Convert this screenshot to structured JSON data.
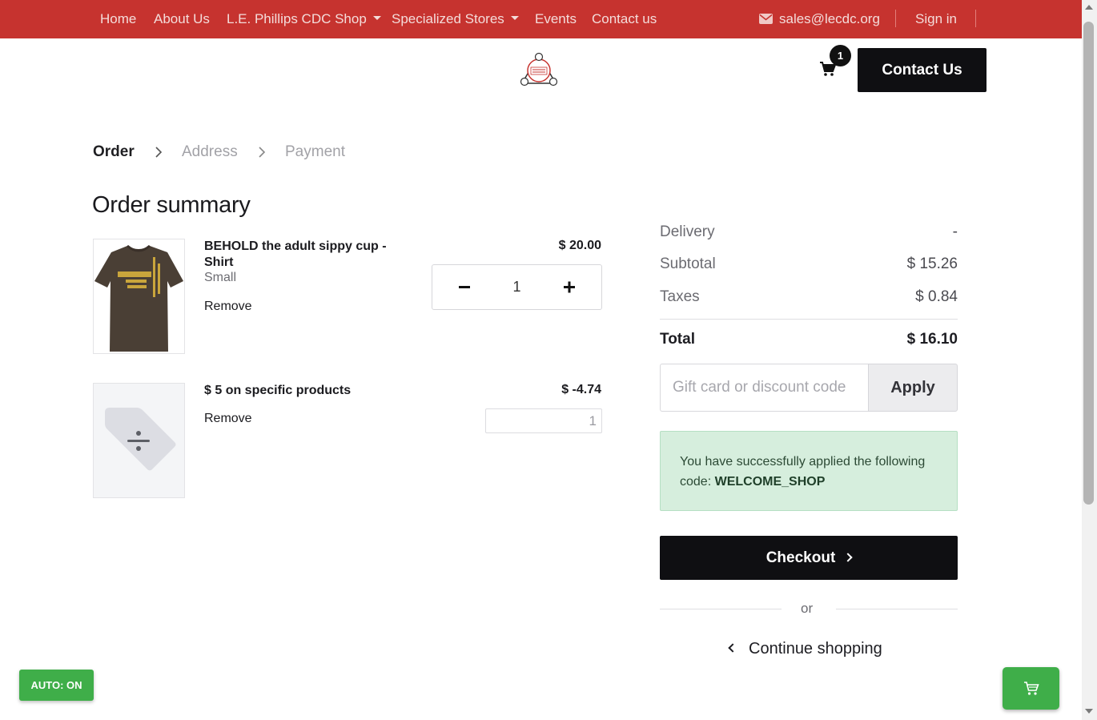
{
  "nav": {
    "items": [
      {
        "label": "Home",
        "dropdown": false
      },
      {
        "label": "About Us",
        "dropdown": false
      },
      {
        "label": "L.E. Phillips CDC Shop",
        "dropdown": true
      },
      {
        "label": "Specialized Stores",
        "dropdown": true
      },
      {
        "label": "Events",
        "dropdown": false
      },
      {
        "label": "Contact us",
        "dropdown": false
      }
    ],
    "email": "sales@lecdc.org",
    "sign_in": "Sign in",
    "background_color": "#c6332f"
  },
  "header": {
    "logo_icon": "cdc-logo-icon",
    "cart_count": "1",
    "contact_button": "Contact Us"
  },
  "steps": [
    {
      "label": "Order",
      "active": true
    },
    {
      "label": "Address",
      "active": false
    },
    {
      "label": "Payment",
      "active": false
    }
  ],
  "order": {
    "title": "Order summary",
    "items": [
      {
        "name": "BEHOLD the adult sippy cup - Shirt",
        "variant": "Small",
        "remove_label": "Remove",
        "price": "$ 20.00",
        "quantity": "1",
        "image_icon": "tshirt-image"
      },
      {
        "name": "$ 5 on specific products",
        "remove_label": "Remove",
        "price": "$ -4.74",
        "quantity": "1",
        "image_icon": "discount-tag-icon"
      }
    ]
  },
  "totals": {
    "delivery_label": "Delivery",
    "delivery_value": "-",
    "subtotal_label": "Subtotal",
    "subtotal_value": "$ 15.26",
    "taxes_label": "Taxes",
    "taxes_value": "$ 0.84",
    "total_label": "Total",
    "total_value": "$ 16.10"
  },
  "promo": {
    "placeholder": "Gift card or discount code",
    "value": "",
    "apply_label": "Apply",
    "success_text": "You have successfully applied the following code:",
    "success_code": "WELCOME_SHOP"
  },
  "actions": {
    "checkout_label": "Checkout",
    "or_label": "or",
    "continue_label": "Continue shopping"
  },
  "widgets": {
    "auto_label": "AUTO: ON",
    "float_cart_icon": "shopping-cart-icon",
    "accent_color": "#3fae49"
  }
}
